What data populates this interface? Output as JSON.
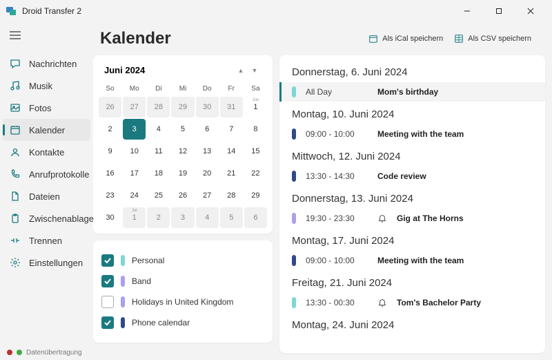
{
  "window": {
    "title": "Droid Transfer 2"
  },
  "sidebar": {
    "items": [
      {
        "label": "Nachrichten",
        "icon": "chat"
      },
      {
        "label": "Musik",
        "icon": "music"
      },
      {
        "label": "Fotos",
        "icon": "photo"
      },
      {
        "label": "Kalender",
        "icon": "calendar",
        "active": true
      },
      {
        "label": "Kontakte",
        "icon": "contact"
      },
      {
        "label": "Anrufprotokolle",
        "icon": "phone"
      },
      {
        "label": "Dateien",
        "icon": "file"
      },
      {
        "label": "Zwischenablage",
        "icon": "clipboard"
      }
    ],
    "bottom": [
      {
        "label": "Trennen",
        "icon": "disconnect"
      },
      {
        "label": "Einstellungen",
        "icon": "settings"
      }
    ]
  },
  "status": {
    "label": "Datenübertragung"
  },
  "page": {
    "title": "Kalender"
  },
  "actions": {
    "ical": "Als iCal speichern",
    "csv": "Als CSV speichern"
  },
  "calendar": {
    "month_label": "Juni 2024",
    "dow": [
      "So",
      "Mo",
      "Di",
      "Mi",
      "Do",
      "Fr",
      "Sa"
    ],
    "cells": [
      {
        "n": "26",
        "other": true
      },
      {
        "n": "27",
        "other": true
      },
      {
        "n": "28",
        "other": true
      },
      {
        "n": "29",
        "other": true
      },
      {
        "n": "30",
        "other": true
      },
      {
        "n": "31",
        "other": true
      },
      {
        "n": "1",
        "mlabel": "Jun"
      },
      {
        "n": "2"
      },
      {
        "n": "3",
        "sel": true
      },
      {
        "n": "4"
      },
      {
        "n": "5"
      },
      {
        "n": "6"
      },
      {
        "n": "7"
      },
      {
        "n": "8"
      },
      {
        "n": "9"
      },
      {
        "n": "10"
      },
      {
        "n": "11"
      },
      {
        "n": "12"
      },
      {
        "n": "13"
      },
      {
        "n": "14"
      },
      {
        "n": "15"
      },
      {
        "n": "16"
      },
      {
        "n": "17"
      },
      {
        "n": "18"
      },
      {
        "n": "19"
      },
      {
        "n": "20"
      },
      {
        "n": "21"
      },
      {
        "n": "22"
      },
      {
        "n": "23"
      },
      {
        "n": "24"
      },
      {
        "n": "25"
      },
      {
        "n": "26"
      },
      {
        "n": "27"
      },
      {
        "n": "28"
      },
      {
        "n": "29"
      },
      {
        "n": "30"
      },
      {
        "n": "1",
        "other": true,
        "mlabel": "Jul"
      },
      {
        "n": "2",
        "other": true
      },
      {
        "n": "3",
        "other": true
      },
      {
        "n": "4",
        "other": true
      },
      {
        "n": "5",
        "other": true
      },
      {
        "n": "6",
        "other": true
      }
    ]
  },
  "legends": [
    {
      "label": "Personal",
      "color": "#7dd8d4",
      "checked": true
    },
    {
      "label": "Band",
      "color": "#a9a0f0",
      "checked": true
    },
    {
      "label": "Holidays in United Kingdom",
      "color": "#a9a0f0",
      "checked": false
    },
    {
      "label": "Phone calendar",
      "color": "#2f4a8a",
      "checked": true
    }
  ],
  "events": [
    {
      "date": "Donnerstag, 6. Juni 2024",
      "items": [
        {
          "time": "All Day",
          "title": "Mom's birthday",
          "color": "#7dd8d4",
          "hl": true
        }
      ]
    },
    {
      "date": "Montag, 10. Juni 2024",
      "items": [
        {
          "time": "09:00 - 10:00",
          "title": "Meeting with the team",
          "color": "#2f4a8a"
        }
      ]
    },
    {
      "date": "Mittwoch, 12. Juni 2024",
      "items": [
        {
          "time": "13:30 - 14:30",
          "title": "Code review",
          "color": "#2f4a8a"
        }
      ]
    },
    {
      "date": "Donnerstag, 13. Juni 2024",
      "items": [
        {
          "time": "19:30 - 23:30",
          "title": "Gig at The Horns",
          "color": "#a9a0f0",
          "bell": true
        }
      ]
    },
    {
      "date": "Montag, 17. Juni 2024",
      "items": [
        {
          "time": "09:00 - 10:00",
          "title": "Meeting with the team",
          "color": "#2f4a8a"
        }
      ]
    },
    {
      "date": "Freitag, 21. Juni 2024",
      "items": [
        {
          "time": "13:30 - 00:30",
          "title": "Tom's Bachelor Party",
          "color": "#7dd8d4",
          "bell": true
        }
      ]
    },
    {
      "date": "Montag, 24. Juni 2024",
      "items": []
    }
  ]
}
